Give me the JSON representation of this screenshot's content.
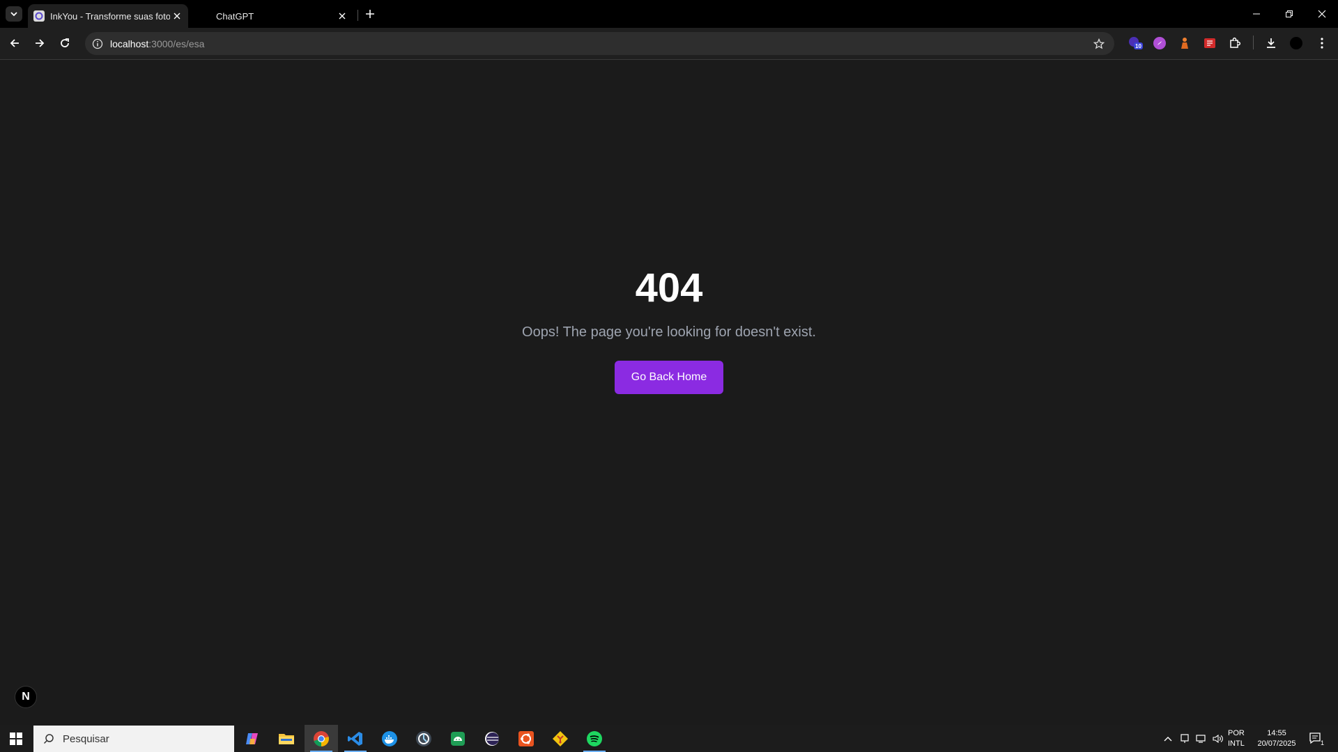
{
  "browser": {
    "tabs": [
      {
        "title": "InkYou - Transforme suas fotos",
        "active": true
      },
      {
        "title": "ChatGPT",
        "active": false
      }
    ],
    "address": {
      "host": "localhost",
      "path": ":3000/es/esa"
    },
    "extensions": [
      {
        "name": "purple-extension-icon",
        "badge": "10"
      },
      {
        "name": "compass-extension-icon"
      },
      {
        "name": "orange-figure-extension-icon"
      },
      {
        "name": "red-box-extension-icon"
      },
      {
        "name": "puzzle-extensions-icon"
      }
    ]
  },
  "page": {
    "error_code": "404",
    "message": "Oops! The page you're looking for doesn't exist.",
    "button_label": "Go Back Home",
    "dev_badge": "N",
    "accent_color": "#8b2be2"
  },
  "taskbar": {
    "search_placeholder": "Pesquisar",
    "apps": [
      "copilot-icon",
      "file-explorer-icon",
      "chrome-icon",
      "vscode-icon",
      "docker-icon",
      "app-icon",
      "android-studio-icon",
      "eclipse-icon",
      "ubuntu-icon",
      "git-icon",
      "spotify-icon"
    ],
    "lang_line1": "POR",
    "lang_line2": "INTL",
    "time": "14:55",
    "date": "20/07/2025",
    "notification_count": "1"
  }
}
